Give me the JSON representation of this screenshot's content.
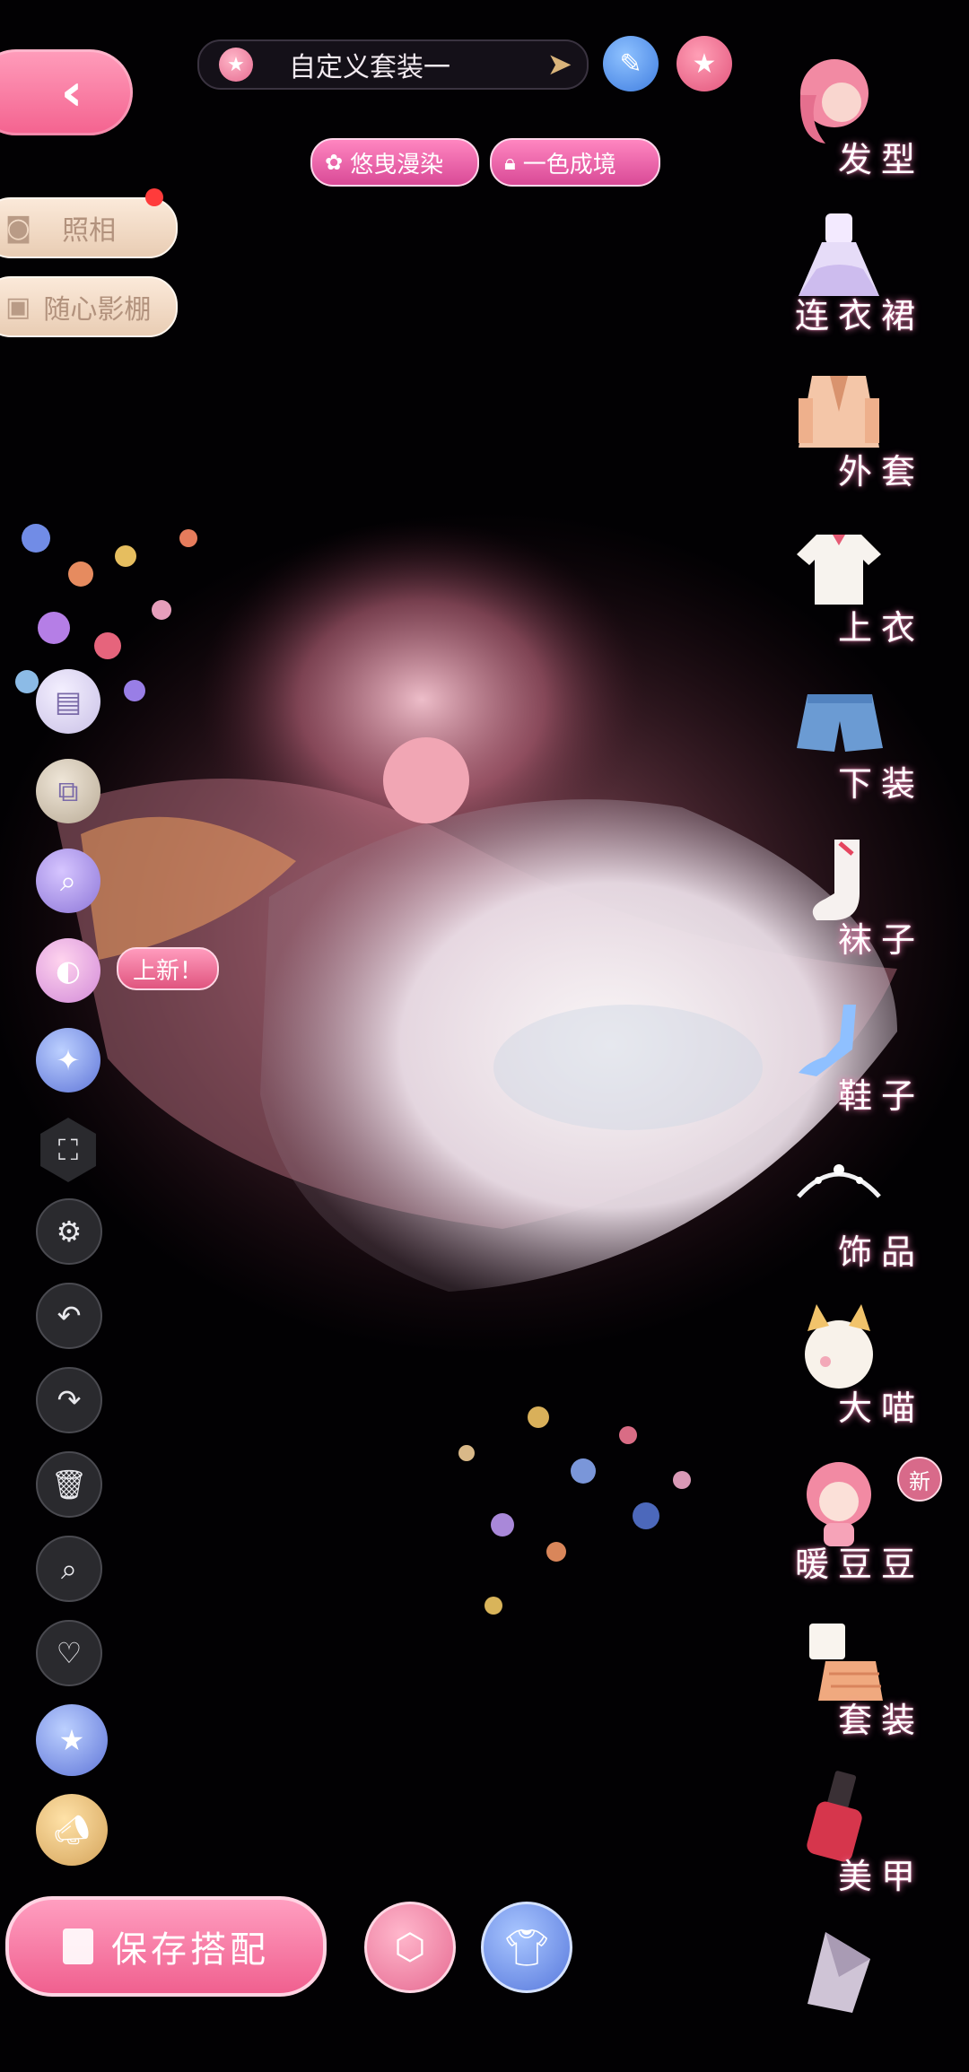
{
  "top": {
    "outfit_name": "自定义套装一",
    "tags": [
      {
        "label": "悠曳漫染",
        "icon": "flower-icon"
      },
      {
        "label": "一色成境",
        "icon": "lock-icon"
      }
    ]
  },
  "side_left": {
    "photo_label": "照相",
    "studio_label": "随心影棚",
    "new_bubble": "上新！"
  },
  "categories": [
    {
      "label": "发型",
      "icon": "hair-icon"
    },
    {
      "label": "连衣裙",
      "icon": "dress-icon"
    },
    {
      "label": "外套",
      "icon": "coat-icon"
    },
    {
      "label": "上衣",
      "icon": "shirt-icon"
    },
    {
      "label": "下装",
      "icon": "shorts-icon"
    },
    {
      "label": "袜子",
      "icon": "sock-icon"
    },
    {
      "label": "鞋子",
      "icon": "shoe-icon"
    },
    {
      "label": "饰品",
      "icon": "tiara-icon"
    },
    {
      "label": "大喵",
      "icon": "cat-icon"
    },
    {
      "label": "暖豆豆",
      "icon": "doll-icon",
      "badge": "新"
    },
    {
      "label": "套装",
      "icon": "outfit-set-icon"
    },
    {
      "label": "美甲",
      "icon": "nail-polish-icon"
    }
  ],
  "bottom": {
    "save_label": "保存搭配"
  },
  "colors": {
    "accent_pink": "#f4628f",
    "accent_blue": "#5778dc",
    "background": "#020103"
  }
}
